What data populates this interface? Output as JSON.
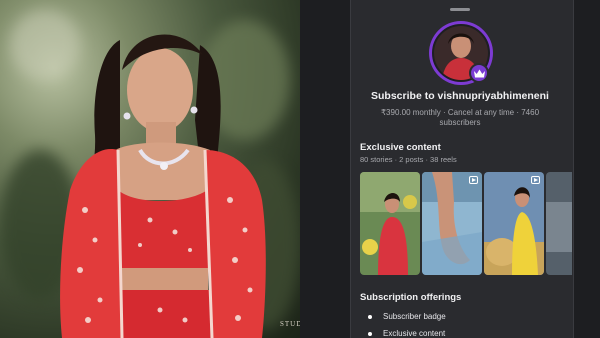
{
  "photo": {
    "watermark": "STUDI"
  },
  "subscription_sheet": {
    "title": "Subscribe to vishnupriyabhimeneni",
    "price_line": "₹390.00 monthly · Cancel at any time · 7460",
    "price_line_2": "subscribers",
    "badge_icon": "crown-icon",
    "accent_color": "#7d3bd3"
  },
  "exclusive_content": {
    "title": "Exclusive content",
    "counts": "80 stories · 2 posts · 38 reels",
    "thumbnails": [
      {
        "type": "photo",
        "icon": ""
      },
      {
        "type": "reel",
        "icon": "reel-icon"
      },
      {
        "type": "reel",
        "icon": "reel-icon"
      },
      {
        "type": "partial",
        "icon": ""
      }
    ]
  },
  "offerings": {
    "title": "Subscription offerings",
    "items": [
      "Subscriber badge",
      "Exclusive content"
    ]
  }
}
